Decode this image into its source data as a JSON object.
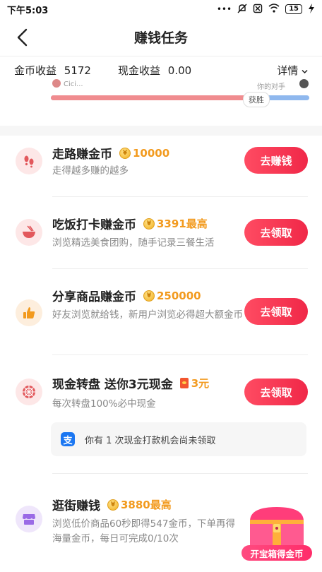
{
  "status": {
    "time": "下午5:03",
    "battery": "15"
  },
  "nav": {
    "title": "赚钱任务"
  },
  "earnings": {
    "gold_label": "金币收益",
    "gold_value": "5172",
    "cash_label": "现金收益",
    "cash_value": "0.00",
    "details_label": "详情"
  },
  "pk": {
    "left_name": "Cici...",
    "right_name": "你的对手",
    "left_ratio": 0.75,
    "badge": "获胜"
  },
  "tasks": [
    {
      "title": "走路赚金币",
      "reward": "10000",
      "desc": "走得越多赚的越多",
      "button": "去赚钱",
      "icon": "footprint-icon"
    },
    {
      "title": "吃饭打卡赚金币",
      "reward": "3391最高",
      "desc": "浏览精选美食团购，随手记录三餐生活",
      "button": "去领取",
      "icon": "bowl-icon"
    },
    {
      "title": "分享商品赚金币",
      "reward": "250000",
      "desc": "好友浏览就给钱，新用户浏览必得超大额金币",
      "button": "去领取",
      "icon": "thumbs-up-icon"
    },
    {
      "title": "现金转盘 送你3元现金",
      "reward": "3元",
      "desc": "每次转盘100%必中现金",
      "button": "去领取",
      "icon": "wheel-icon"
    },
    {
      "title": "逛街赚钱",
      "reward": "3880最高",
      "desc": "浏览低价商品60秒即得547金币，下单再得海量金币，每日可完成0/10次",
      "icon": "shop-icon"
    }
  ],
  "coin_symbol": "¥",
  "alipay": {
    "icon_char": "支",
    "text": "你有 1 次现金打款机会尚未领取"
  },
  "treasure": {
    "label": "开宝箱得金币"
  },
  "colors": {
    "accent": "#f02848",
    "gold": "#f29a1e"
  }
}
